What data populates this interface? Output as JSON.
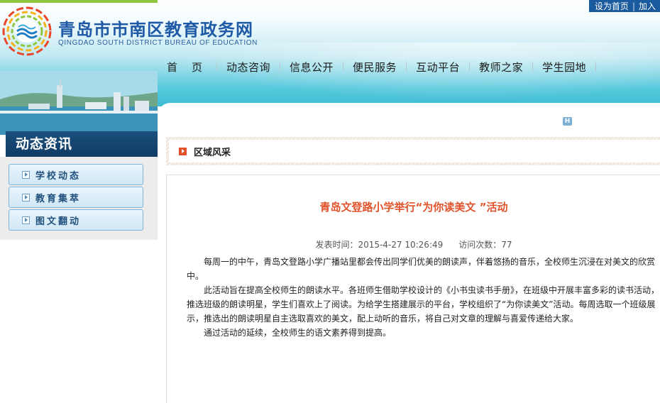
{
  "header": {
    "site_title": "青岛市市南区教育政务网",
    "site_subtitle": "QINGDAO SOUTH DISTRICT BUREAU OF EDUCATION",
    "top_links": [
      "设为首页",
      "加入"
    ]
  },
  "nav": {
    "items": [
      "首页",
      "动态咨询",
      "信息公开",
      "便民服务",
      "互动平台",
      "教师之家",
      "学生园地"
    ]
  },
  "sidebar": {
    "title": "动态资讯",
    "items": [
      "学校动态",
      "教育集萃",
      "图文翻动"
    ]
  },
  "breadcrumb": {
    "label": "区域风采"
  },
  "article": {
    "title": "青岛文登路小学举行“为你读美文 ”活动",
    "published_label": "发表时间：2015-4-27 10:26:49",
    "visits_label": "访问次数：77",
    "paragraphs": [
      "每周一的中午，青岛文登路小学广播站里都会传出同学们优美的朗读声，伴着悠扬的音乐，全校师生沉浸在对美文的欣赏中。",
      "此活动旨在提高全校师生的朗读水平。各班师生借助学校设计的《小书虫读书手册》，在班级中开展丰富多彩的读书活动，推选班级的朗读明星，学生们喜欢上了阅读。为给学生搭建展示的平台，学校组织了“为你读美文”活动。每周选取一个班级展示，推选出的朗读明星自主选取喜欢的美文，配上动听的音乐，将自己对文章的理解与喜爱传递给大家。",
      "通过活动的延续，全校师生的语文素养得到提高。"
    ]
  },
  "colors": {
    "accent_title": "#e0532b",
    "brand_blue": "#1f5aa7",
    "sidebar_dark": "#0f3b63"
  }
}
